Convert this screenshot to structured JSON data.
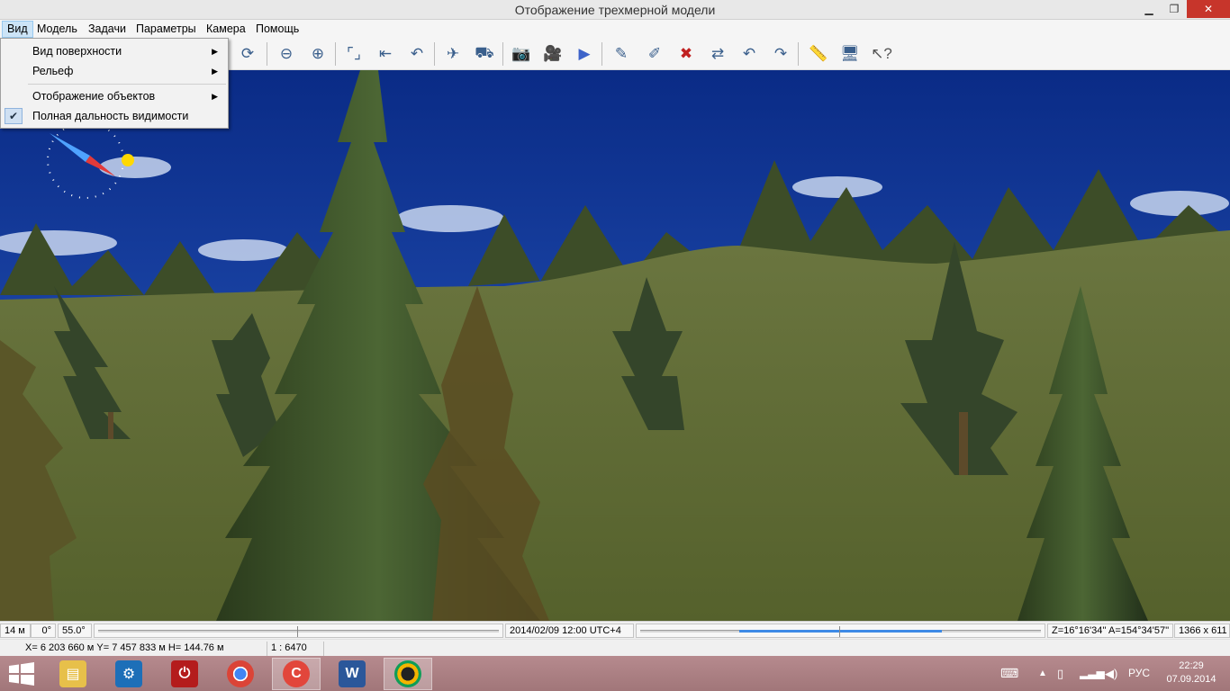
{
  "window": {
    "title": "Отображение трехмерной модели"
  },
  "menu": [
    "Вид",
    "Модель",
    "Задачи",
    "Параметры",
    "Камера",
    "Помощь"
  ],
  "view_menu": {
    "items": [
      {
        "label": "Вид поверхности",
        "submenu": true
      },
      {
        "label": "Рельеф",
        "submenu": true
      },
      {
        "label": "Отображение объектов",
        "submenu": true
      },
      {
        "label": "Полная дальность видимости",
        "checked": true
      }
    ]
  },
  "toolbar_icons": [
    "rotate-icon",
    "zoom-out-icon",
    "zoom-in-icon",
    "fit-view-icon",
    "back-icon",
    "turn-icon",
    "helicopter-icon",
    "vehicle-icon",
    "camera-icon",
    "video-camera-icon",
    "play-icon",
    "draw-icon",
    "draw-plus-icon",
    "delete-icon",
    "move-icon",
    "undo-icon",
    "redo-icon",
    "ruler-icon",
    "monitor-icon",
    "help-cursor-icon"
  ],
  "status": {
    "scale_dist": "14 м",
    "angle": "0°",
    "fov": "55.0°",
    "datetime": "2014/02/09  12:00  UTC+4",
    "orientation": "Z=16°16'34''  A=154°34'57''",
    "resolution": "1366 x 611",
    "coords": "X= 6 203 660 м  Y= 7 457 833 м  H= 144.76 м",
    "scale": "1 : 6470"
  },
  "taskbar": {
    "apps": [
      "file-explorer-icon",
      "control-panel-icon",
      "power-icon",
      "chrome-icon",
      "ccleaner-icon",
      "word-icon",
      "3d-model-app-icon"
    ],
    "language": "РУС",
    "time": "22:29",
    "date": "07.09.2014"
  },
  "colors": {
    "sky": "#0c2f8e",
    "ground": "#5f6b35",
    "accent": "#3d8ae6"
  }
}
